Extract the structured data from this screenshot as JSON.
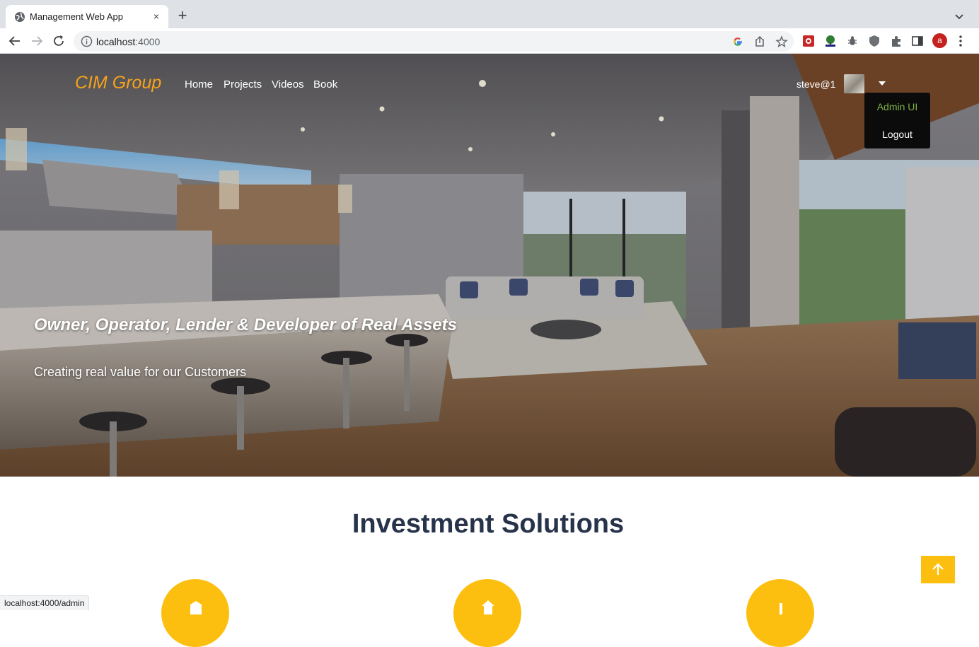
{
  "browser": {
    "tab_title": "Management Web App",
    "new_tab_label": "+",
    "close_label": "×",
    "url_host": "localhost",
    "url_port": ":4000",
    "profile_initial": "a",
    "status_url": "localhost:4000/admin"
  },
  "navbar": {
    "brand": "CIM Group",
    "links": [
      "Home",
      "Projects",
      "Videos",
      "Book"
    ],
    "user": "steve@1"
  },
  "user_menu": {
    "items": [
      "Admin UI",
      "Logout"
    ]
  },
  "hero": {
    "title": "Owner, Operator, Lender & Developer of Real Assets",
    "subtitle": "Creating real value for our Customers"
  },
  "section": {
    "title": "Investment Solutions",
    "solution_icons": [
      "building-icon",
      "home-icon",
      "chart-icon"
    ]
  },
  "colors": {
    "brand": "#f6a21a",
    "accent": "#fdbf0f",
    "heading": "#26334a",
    "menu_active": "#7cb342"
  }
}
